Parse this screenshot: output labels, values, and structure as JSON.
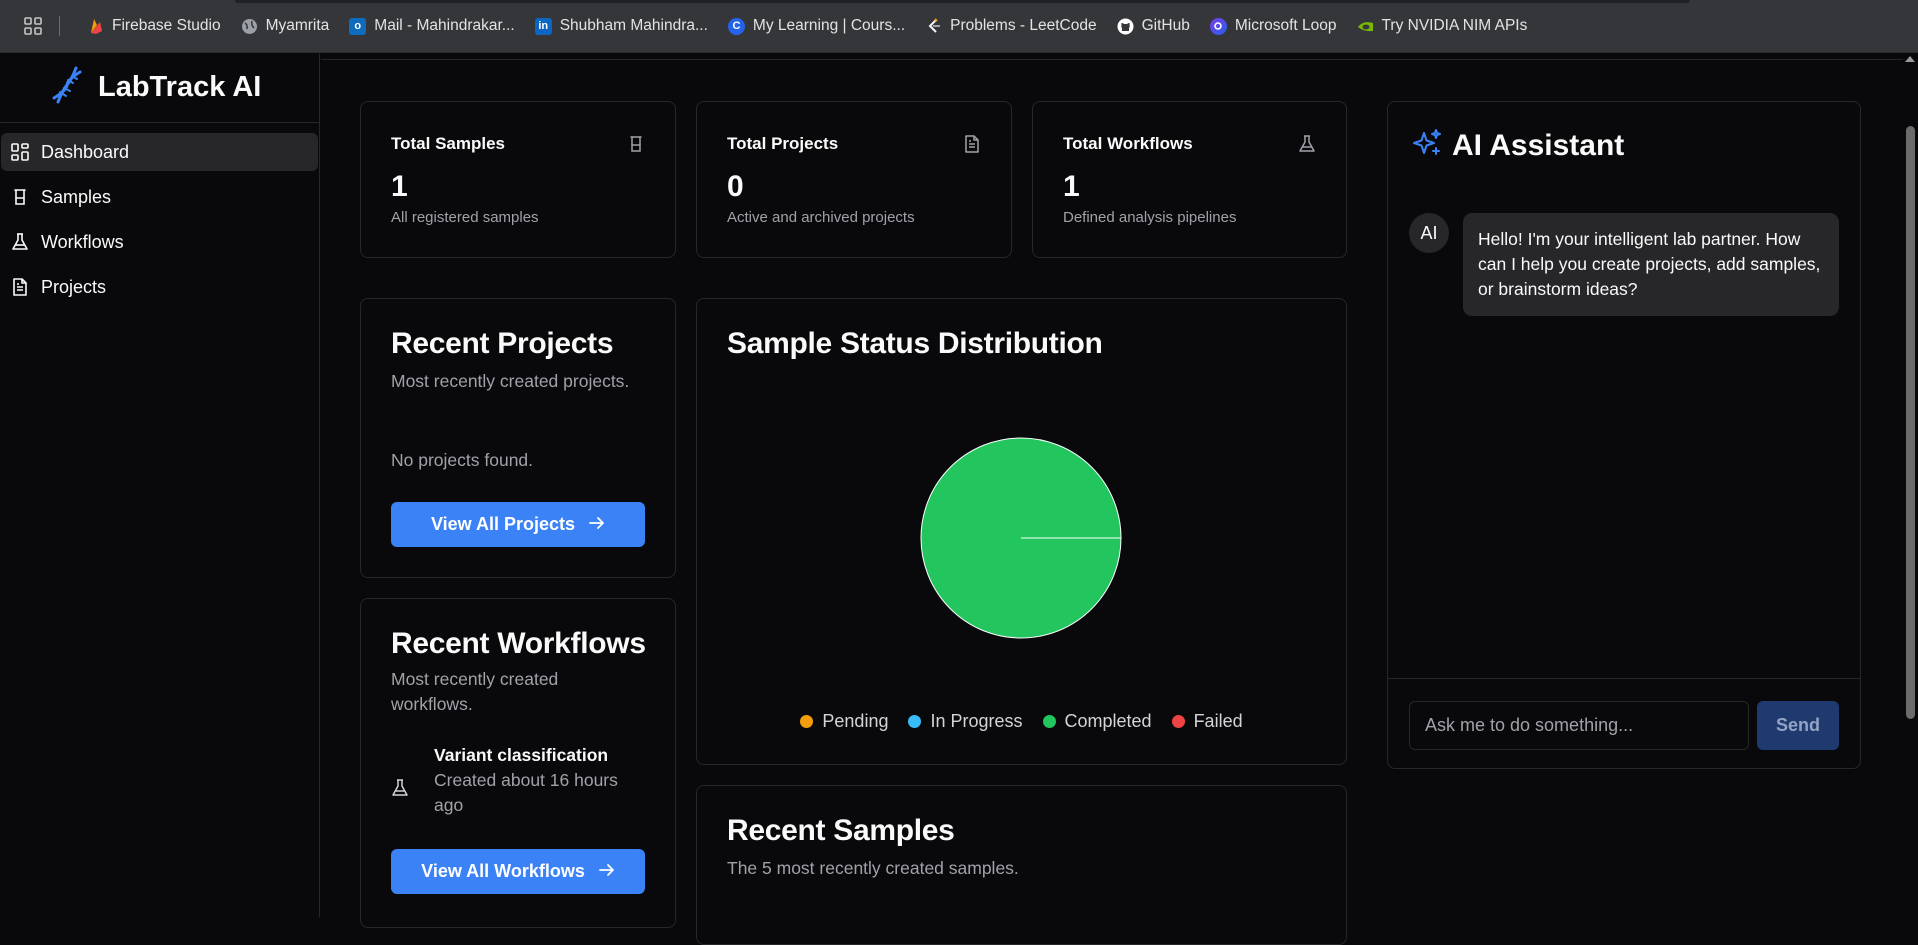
{
  "bookmarks": [
    {
      "label": "Firebase Studio",
      "icon": "firebase-icon",
      "color": "#f97316"
    },
    {
      "label": "Myamrita",
      "icon": "globe-icon",
      "color": "#9aa0a6"
    },
    {
      "label": "Mail - Mahindrakar...",
      "icon": "outlook-icon",
      "color": "#0f6cbd"
    },
    {
      "label": "Shubham Mahindra...",
      "icon": "linkedin-icon",
      "color": "#0a66c2"
    },
    {
      "label": "My Learning | Cours...",
      "icon": "coursera-icon",
      "color": "#2563eb"
    },
    {
      "label": "Problems - LeetCode",
      "icon": "leetcode-icon",
      "color": "#f59e0b"
    },
    {
      "label": "GitHub",
      "icon": "github-icon",
      "color": "#ffffff"
    },
    {
      "label": "Microsoft Loop",
      "icon": "loop-icon",
      "color": "#7c3aed"
    },
    {
      "label": "Try NVIDIA NIM APIs",
      "icon": "nvidia-icon",
      "color": "#76b900"
    }
  ],
  "app": {
    "name": "LabTrack AI",
    "accent": "#3b82f6"
  },
  "sidebar": {
    "items": [
      {
        "label": "Dashboard",
        "icon": "dashboard-icon",
        "active": true
      },
      {
        "label": "Samples",
        "icon": "test-tube-icon",
        "active": false
      },
      {
        "label": "Workflows",
        "icon": "flask-icon",
        "active": false
      },
      {
        "label": "Projects",
        "icon": "document-icon",
        "active": false
      }
    ]
  },
  "stats": [
    {
      "title": "Total Samples",
      "value": "1",
      "desc": "All registered samples",
      "icon": "test-tube-icon"
    },
    {
      "title": "Total Projects",
      "value": "0",
      "desc": "Active and archived projects",
      "icon": "document-icon"
    },
    {
      "title": "Total Workflows",
      "value": "1",
      "desc": "Defined analysis pipelines",
      "icon": "flask-icon"
    }
  ],
  "recent_projects": {
    "title": "Recent Projects",
    "subtitle": "Most recently created projects.",
    "empty": "No projects found.",
    "button": "View All Projects"
  },
  "recent_workflows": {
    "title": "Recent Workflows",
    "subtitle": "Most recently created workflows.",
    "items": [
      {
        "name": "Variant classification",
        "created": "Created about 16 hours ago"
      }
    ],
    "button": "View All Workflows"
  },
  "status_chart": {
    "title": "Sample Status Distribution"
  },
  "chart_data": {
    "type": "pie",
    "categories": [
      "Pending",
      "In Progress",
      "Completed",
      "Failed"
    ],
    "values": [
      0,
      0,
      1,
      0
    ],
    "colors": [
      "#f59e0b",
      "#38bdf8",
      "#22c55e",
      "#ef4444"
    ],
    "legend": "bottom"
  },
  "recent_samples": {
    "title": "Recent Samples",
    "subtitle": "The 5 most recently created samples."
  },
  "assistant": {
    "title": "AI Assistant",
    "avatar": "AI",
    "message": "Hello! I'm your intelligent lab partner. How can I help you create projects, add samples, or brainstorm ideas?",
    "input_value": "",
    "placeholder": "Ask me to do something...",
    "send": "Send"
  }
}
